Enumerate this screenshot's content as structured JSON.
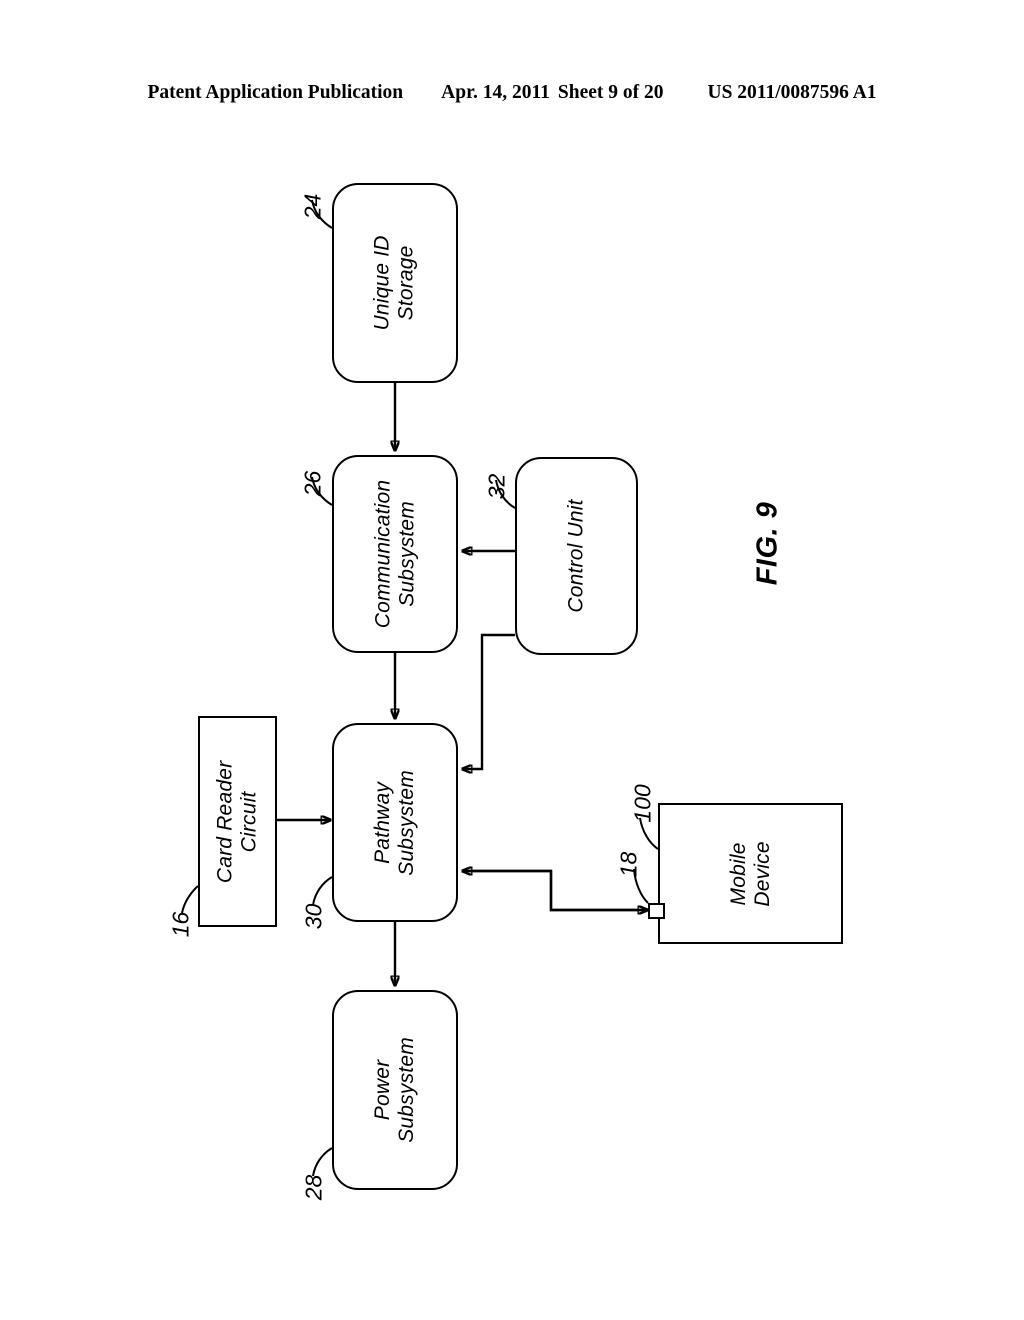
{
  "header": {
    "publication": "Patent Application Publication",
    "date": "Apr. 14, 2011",
    "sheet": "Sheet 9 of 20",
    "patent_number": "US 2011/0087596 A1"
  },
  "figure": {
    "label": "FIG. 9",
    "type": "block-diagram",
    "orientation": "rotated-90-ccw"
  },
  "blocks": [
    {
      "id": "unique_id_storage",
      "label": "Unique ID\nStorage",
      "numeral": "24",
      "shape": "rounded"
    },
    {
      "id": "communication_subsystem",
      "label": "Communication\nSubsystem",
      "numeral": "26",
      "shape": "rounded"
    },
    {
      "id": "control_unit",
      "label": "Control Unit",
      "numeral": "32",
      "shape": "rounded"
    },
    {
      "id": "pathway_subsystem",
      "label": "Pathway\nSubsystem",
      "numeral": "30",
      "shape": "rounded"
    },
    {
      "id": "card_reader_circuit",
      "label": "Card Reader\nCircuit",
      "numeral": "16",
      "shape": "square"
    },
    {
      "id": "power_subsystem",
      "label": "Power\nSubsystem",
      "numeral": "28",
      "shape": "rounded"
    },
    {
      "id": "mobile_device",
      "label": "Mobile\nDevice",
      "numeral": "100",
      "shape": "square"
    },
    {
      "id": "connector",
      "label": "",
      "numeral": "18",
      "shape": "square"
    }
  ],
  "labels": {
    "unique_id_storage_line1": "Unique ID",
    "unique_id_storage_line2": "Storage",
    "communication_line1": "Communication",
    "communication_line2": "Subsystem",
    "control_unit": "Control Unit",
    "pathway_line1": "Pathway",
    "pathway_line2": "Subsystem",
    "card_reader_line1": "Card Reader",
    "card_reader_line2": "Circuit",
    "power_line1": "Power",
    "power_line2": "Subsystem",
    "mobile_device_line1": "Mobile",
    "mobile_device_line2": "Device"
  },
  "numerals": {
    "n24": "24",
    "n26": "26",
    "n32": "32",
    "n30": "30",
    "n16": "16",
    "n28": "28",
    "n100": "100",
    "n18": "18"
  },
  "connections": [
    {
      "from": "unique_id_storage",
      "to": "communication_subsystem",
      "arrow": "single"
    },
    {
      "from": "communication_subsystem",
      "to": "pathway_subsystem",
      "arrow": "single"
    },
    {
      "from": "control_unit",
      "to": "communication_subsystem",
      "arrow": "single"
    },
    {
      "from": "control_unit",
      "to": "pathway_subsystem",
      "arrow": "single"
    },
    {
      "from": "card_reader_circuit",
      "to": "pathway_subsystem",
      "arrow": "single"
    },
    {
      "from": "pathway_subsystem",
      "to": "power_subsystem",
      "arrow": "single"
    },
    {
      "from": "mobile_device",
      "to": "pathway_subsystem",
      "arrow": "bidirectional"
    }
  ],
  "colors": {
    "ink": "#000000",
    "paper": "#ffffff"
  }
}
